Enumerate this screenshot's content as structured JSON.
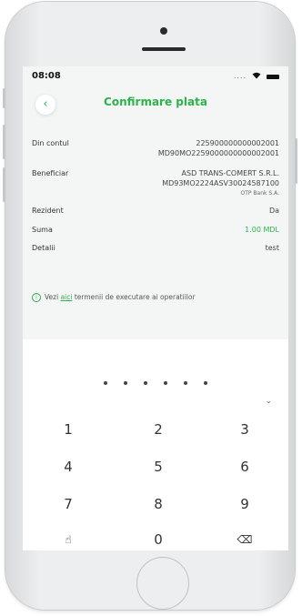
{
  "status_bar": {
    "time": "08:08",
    "signal": "...."
  },
  "header": {
    "back_icon": "‹",
    "title": "Confirmare plata"
  },
  "details": {
    "from_account": {
      "label": "Din contul",
      "value_1": "225900000000002001",
      "value_2": "MD90MO2259000000000002001"
    },
    "beneficiary": {
      "label": "Beneficiar",
      "name": "ASD TRANS-COMERT S.R.L.",
      "iban": "MD93MO2224ASV30024587100",
      "bank": "OTP Bank S.A."
    },
    "resident": {
      "label": "Rezident",
      "value": "Da"
    },
    "amount": {
      "label": "Suma",
      "value": "1.00 MDL"
    },
    "details": {
      "label": "Detalii",
      "value": "test"
    }
  },
  "info": {
    "icon": "i",
    "prefix": "Vezi ",
    "link": "aici",
    "suffix": " termenii de executare ai operatiilor"
  },
  "keypad": {
    "keys": [
      "1",
      "2",
      "3",
      "4",
      "5",
      "6",
      "7",
      "8",
      "9"
    ],
    "zero": "0",
    "biometric_icon": "☝",
    "delete_icon": "⌫",
    "collapse_icon": "⌄"
  },
  "colors": {
    "accent": "#2cb34a",
    "screen_bg": "#f4f6f6"
  }
}
